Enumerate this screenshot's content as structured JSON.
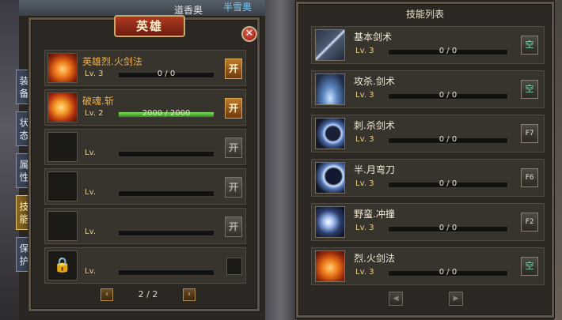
{
  "world": {
    "name_left": "道香奥",
    "name_right": "半雪奥"
  },
  "hero_panel": {
    "title": "英雄",
    "close_glyph": "✕",
    "slots": [
      {
        "name": "英雄烈.火剑法",
        "lv": "Lv. 3",
        "bar_text": "0 / 0",
        "bar_fill": 0,
        "button": "开",
        "button_state": "active",
        "icon": "fire-sword-icon",
        "locked": false
      },
      {
        "name": "破魂.斩",
        "lv": "Lv. 2",
        "bar_text": "2000 / 2000",
        "bar_fill": 1,
        "button": "开",
        "button_state": "active",
        "icon": "fire-slash-icon",
        "locked": false
      },
      {
        "name": "",
        "lv": "Lv.",
        "bar_text": "",
        "bar_fill": 0,
        "button": "开",
        "button_state": "disabled",
        "icon": "",
        "locked": false
      },
      {
        "name": "",
        "lv": "Lv.",
        "bar_text": "",
        "bar_fill": 0,
        "button": "开",
        "button_state": "disabled",
        "icon": "",
        "locked": false
      },
      {
        "name": "",
        "lv": "Lv.",
        "bar_text": "",
        "bar_fill": 0,
        "button": "开",
        "button_state": "disabled",
        "icon": "",
        "locked": false
      },
      {
        "name": "",
        "lv": "Lv.",
        "bar_text": "",
        "bar_fill": 0,
        "button": "",
        "button_state": "empty",
        "icon": "lock-icon",
        "locked": true
      }
    ],
    "pager": {
      "prev": "‹",
      "next": "›",
      "text": "2 / 2"
    }
  },
  "side_tabs": [
    {
      "label": "装备",
      "active": false
    },
    {
      "label": "状态",
      "active": false
    },
    {
      "label": "属性",
      "active": false
    },
    {
      "label": "技能",
      "active": true
    },
    {
      "label": "保护",
      "active": false
    }
  ],
  "skill_panel": {
    "title": "技能列表",
    "skills": [
      {
        "name": "基本剑术",
        "lv": "Lv. 3",
        "bar_text": "0 / 0",
        "key": "空",
        "icon": "sword-icon"
      },
      {
        "name": "攻杀.剑术",
        "lv": "Lv. 3",
        "bar_text": "0 / 0",
        "key": "空",
        "icon": "slash-icon"
      },
      {
        "name": "刺.杀剑术",
        "lv": "Lv. 3",
        "bar_text": "0 / 0",
        "key": "F7",
        "icon": "thrust-icon"
      },
      {
        "name": "半.月弯刀",
        "lv": "Lv. 3",
        "bar_text": "0 / 0",
        "key": "F6",
        "icon": "half-moon-icon"
      },
      {
        "name": "野蛮.冲撞",
        "lv": "Lv. 3",
        "bar_text": "0 / 0",
        "key": "F2",
        "icon": "charge-icon"
      },
      {
        "name": "烈.火剑法",
        "lv": "Lv. 3",
        "bar_text": "0 / 0",
        "key": "空",
        "icon": "fire-sword-icon"
      }
    ],
    "pager": {
      "prev": "◀",
      "next": "▶"
    }
  }
}
